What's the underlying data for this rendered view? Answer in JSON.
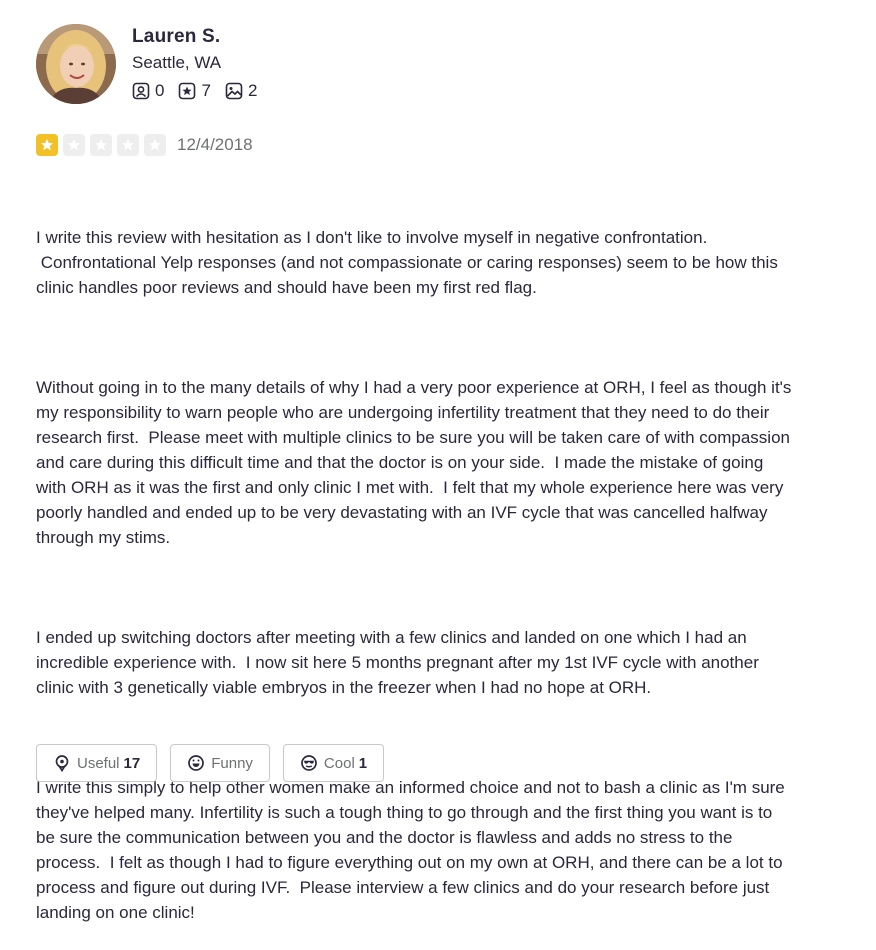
{
  "user": {
    "name": "Lauren S.",
    "location": "Seattle, WA",
    "stats": {
      "friends": "0",
      "reviews": "7",
      "photos": "2"
    }
  },
  "review": {
    "rating": 1,
    "max_rating": 5,
    "date": "12/4/2018",
    "paragraphs": [
      "I write this review with hesitation as I don't like to involve myself in negative confrontation.\n Confrontational Yelp responses (and not compassionate or caring responses) seem to be how this\nclinic handles poor reviews and should have been my first red flag.",
      "Without going in to the many details of why I had a very poor experience at ORH, I feel as though it's\nmy responsibility to warn people who are undergoing infertility treatment that they need to do their\nresearch first.  Please meet with multiple clinics to be sure you will be taken care of with compassion\nand care during this difficult time and that the doctor is on your side.  I made the mistake of going\nwith ORH as it was the first and only clinic I met with.  I felt that my whole experience here was very\npoorly handled and ended up to be very devastating with an IVF cycle that was cancelled halfway\nthrough my stims.",
      "I ended up switching doctors after meeting with a few clinics and landed on one which I had an\nincredible experience with.  I now sit here 5 months pregnant after my 1st IVF cycle with another\nclinic with 3 genetically viable embryos in the freezer when I had no hope at ORH.",
      "I write this simply to help other women make an informed choice and not to bash a clinic as I'm sure\nthey've helped many. Infertility is such a tough thing to go through and the first thing you want is to\nbe sure the communication between you and the doctor is flawless and adds no stress to the\nprocess.  I felt as though I had to figure everything out on my own at ORH, and there can be a lot to\nprocess and figure out during IVF.  Please interview a few clinics and do your research before just\nlanding on one clinic!"
    ]
  },
  "reactions": {
    "useful": {
      "label": "Useful",
      "count": "17"
    },
    "funny": {
      "label": "Funny",
      "count": ""
    },
    "cool": {
      "label": "Cool",
      "count": "1"
    }
  },
  "icons": {
    "friends": "friends-icon",
    "reviews": "star-badge-icon",
    "photos": "photo-icon",
    "useful": "lightbulb-icon",
    "funny": "smile-icon",
    "cool": "sunglasses-icon",
    "star": "star-icon"
  },
  "colors": {
    "star_filled": "#f2c027",
    "star_empty": "#eeeeef",
    "text": "#2b273c",
    "muted": "#6e7072",
    "border": "#c8c9ca"
  }
}
